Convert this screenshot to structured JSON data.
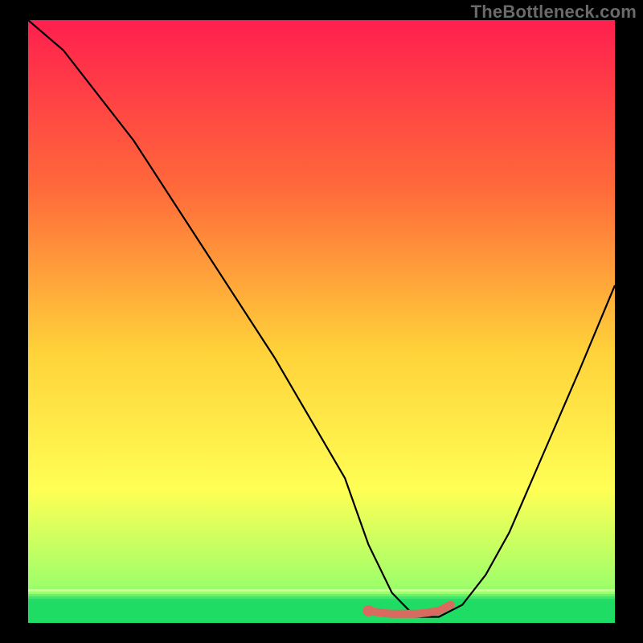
{
  "watermark": "TheBottleneck.com",
  "chart_data": {
    "type": "line",
    "title": "",
    "xlabel": "",
    "ylabel": "",
    "xlim": [
      0,
      100
    ],
    "ylim": [
      0,
      100
    ],
    "grid": false,
    "series": [
      {
        "name": "bottleneck-curve",
        "x": [
          0,
          6,
          18,
          30,
          42,
          54,
          58,
          62,
          66,
          70,
          74,
          78,
          82,
          86,
          90,
          94,
          100
        ],
        "values": [
          100,
          95,
          80,
          62,
          44,
          24,
          13,
          5,
          1,
          1,
          3,
          8,
          15,
          24,
          33,
          42,
          56
        ]
      }
    ],
    "marker": {
      "name": "optimal-segment",
      "x": [
        58,
        60,
        62,
        64,
        66,
        68,
        70,
        71,
        72
      ],
      "values": [
        2,
        1.7,
        1.5,
        1.5,
        1.5,
        1.7,
        2,
        2.5,
        3
      ],
      "color": "#d86a5f",
      "point": {
        "x": 58,
        "y": 2
      }
    },
    "background_gradient": {
      "top": "#ff1f4e",
      "mid1": "#ff6a3a",
      "mid2": "#ffd23a",
      "mid3": "#ffff55",
      "bottom": "#9eff6a",
      "green": "#1edc64"
    }
  }
}
